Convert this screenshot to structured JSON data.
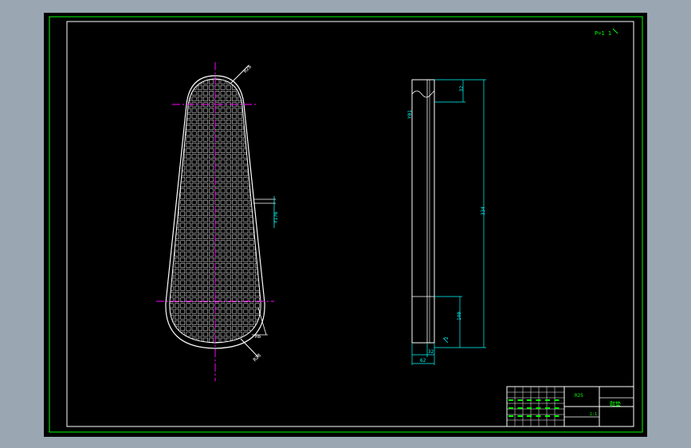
{
  "colors": {
    "canvas": "#000000",
    "frame": "#00ff00",
    "outline": "#ffffff",
    "centerline": "#ff00ff",
    "dimension": "#00ffff",
    "titlebar_text": "#00ff00",
    "window_bg": "#9aa6b2"
  },
  "corner_note": "P=1 1",
  "front_view": {
    "radius_top": "R28",
    "radius_bottom": "R28",
    "width_label": "Y176",
    "tail_label": "R6"
  },
  "side_view": {
    "dim_top": "32",
    "dim_total": "334",
    "dim_lower": "140",
    "dim_small": "2",
    "dim_bottom_1": "32",
    "dim_bottom_2": "62",
    "side_note": "Y01"
  },
  "title_block": {
    "material": "R25",
    "name": "鞋垫",
    "scale": "1:1"
  }
}
